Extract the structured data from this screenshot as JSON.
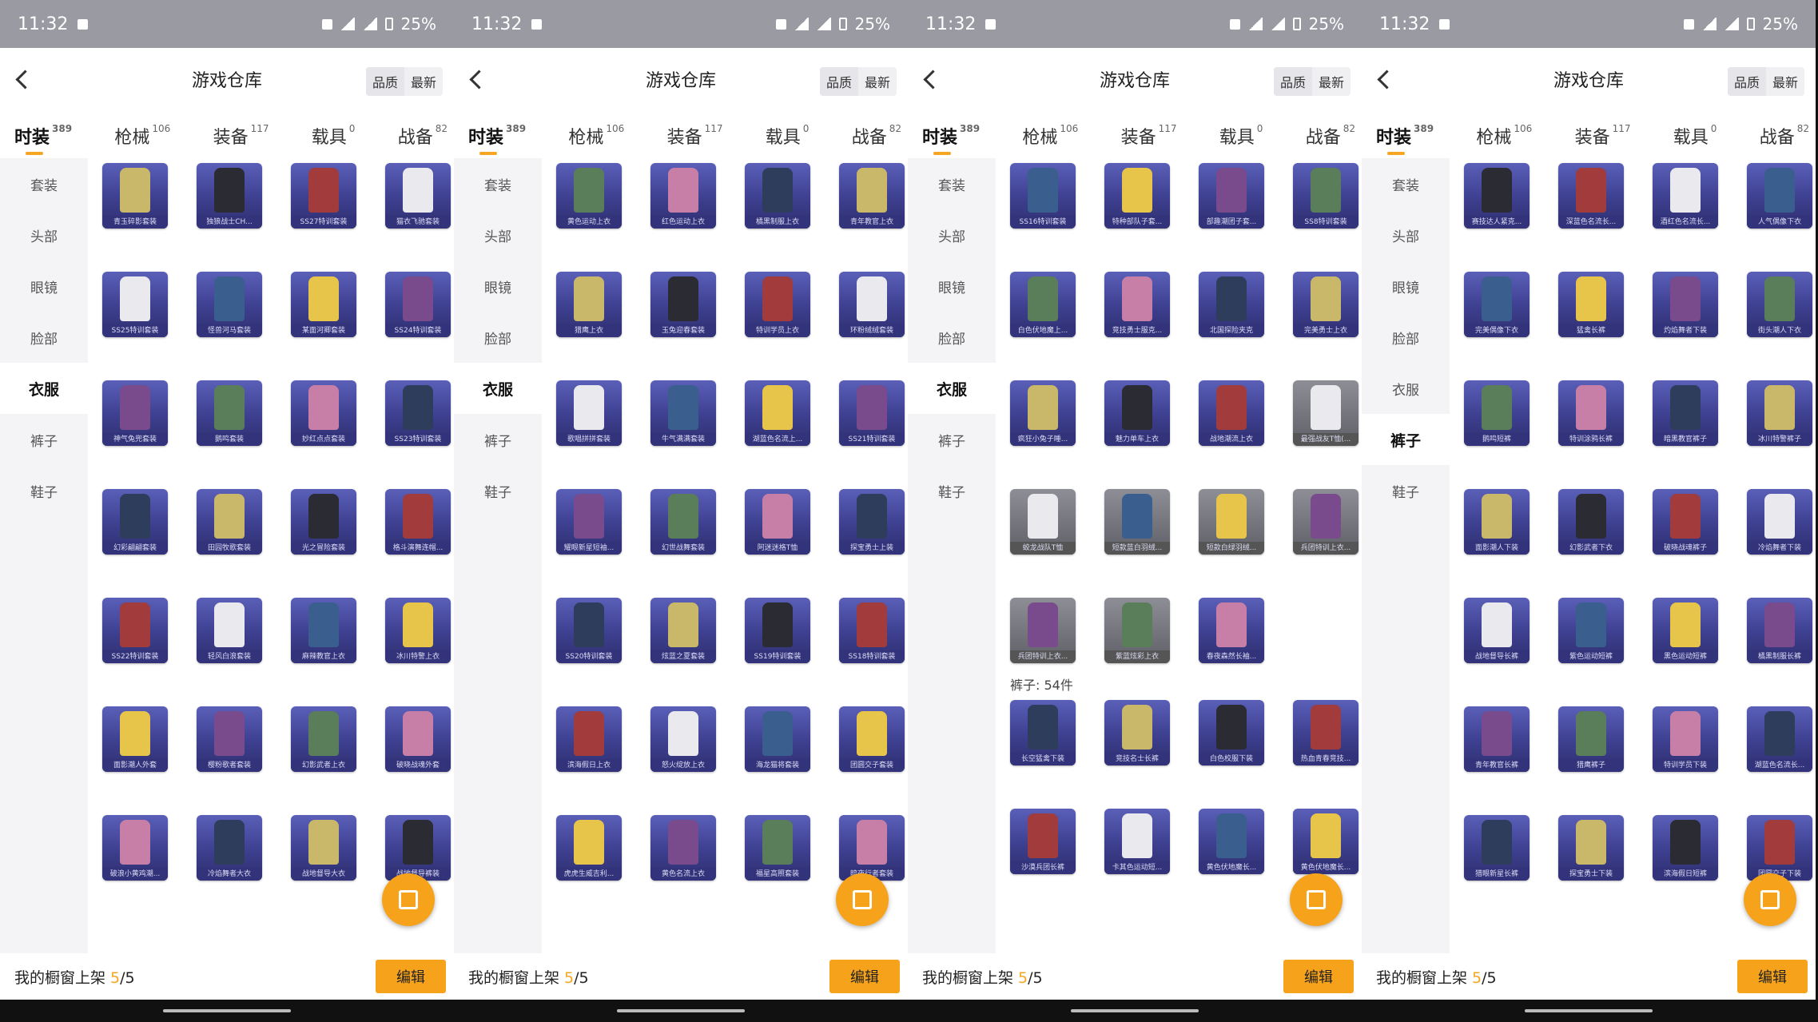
{
  "status": {
    "time": "11:32",
    "battery": "25%"
  },
  "header": {
    "title": "游戏仓库",
    "sort_quality": "品质",
    "sort_latest": "最新"
  },
  "tabs": [
    {
      "label": "时装",
      "count": "389"
    },
    {
      "label": "枪械",
      "count": "106"
    },
    {
      "label": "装备",
      "count": "117"
    },
    {
      "label": "载具",
      "count": "0"
    },
    {
      "label": "战备",
      "count": "82"
    }
  ],
  "side": [
    "套装",
    "头部",
    "眼镜",
    "脸部",
    "衣服",
    "裤子",
    "鞋子"
  ],
  "footer": {
    "label": "我的橱窗上架 ",
    "count": "5",
    "total": "/5",
    "edit": "编辑"
  },
  "colors": {
    "accent": "#f6a21b",
    "card": "#3d3f8f"
  },
  "panels": [
    {
      "active_side": 4,
      "rows": [
        [
          "青玉碎影套装",
          "独狼战士CH...",
          "SS27特训套装",
          "猫衣飞驰套装"
        ],
        [
          "SS25特训套装",
          "怪兽河马套装",
          "某面河卿套装",
          "SS24特训套装"
        ],
        [
          "神气兔兜套装",
          "鹅鸣套装",
          "妙红点点套装",
          "SS23特训套装"
        ],
        [
          "幻彩翩翩套装",
          "田园牧歌套装",
          "光之冒险套装",
          "格斗演舞连帽..."
        ],
        [
          "SS22特训套装",
          "轻风白浪套装",
          "麻辣教官上衣",
          "冰川特警上衣"
        ],
        [
          "面影潮人外套",
          "樱粉歌者套装",
          "幻影武者上衣",
          "破晓战魂外套"
        ],
        [
          "破浪小黄鸡潮...",
          "冷焰舞者大衣",
          "战地督导大衣",
          "战地督导裤装"
        ]
      ]
    },
    {
      "active_side": 4,
      "rows": [
        [
          "黄色运动上衣",
          "红色运动上衣",
          "橘黑制服上衣",
          "青年教官上衣"
        ],
        [
          "猎鹰上衣",
          "玉兔迎春套装",
          "特训学员上衣",
          "环粉绒绒套装"
        ],
        [
          "歌唱拼拼套装",
          "牛气满满套装",
          "湖蓝色名流上...",
          "SS21特训套装"
        ],
        [
          "耀眼新星短袖...",
          "幻世战舞套装",
          "阿迷迷格T恤",
          "探宝勇士上装"
        ],
        [
          "SS20特训套装",
          "炫蓝之夏套装",
          "SS19特训套装",
          "SS18特训套装"
        ],
        [
          "滨海假日上衣",
          "怒火绽放上衣",
          "海龙猫将套装",
          "团圆交子套装"
        ],
        [
          "虎虎生威吉利...",
          "黄色名流上衣",
          "福星高照套装",
          "暗夜行者套装"
        ]
      ]
    },
    {
      "active_side": 4,
      "section": "裤子: 54件",
      "rows": [
        [
          "SS16特训套装",
          "特种部队子套...",
          "部趣潮团子套...",
          "SS8特训套装"
        ],
        [
          "白色伏地魔上...",
          "竞技勇士服克...",
          "北国探险夹克",
          "完美勇士上衣"
        ],
        [
          "疯狂小兔子睡...",
          "魅力单车上衣",
          "战地潮流上衣",
          "最强战友T恤(..."
        ],
        [
          "蛟龙战队T恤",
          "短款蓝白羽绒...",
          "短款白绿羽绒...",
          "兵团特训上衣..."
        ],
        [
          "兵团特训上衣...",
          "紫蓝炫彩上衣",
          "春夜森然长袖..."
        ],
        [
          "长空猛禽下装",
          "竞技名士长裤",
          "白色校服下装",
          "热血青春竞技..."
        ],
        [
          "沙漠兵团长裤",
          "卡其色运动短...",
          "黄色伏地魔长...",
          "黄色伏地魔长..."
        ]
      ]
    },
    {
      "active_side": 5,
      "rows": [
        [
          "赛技达人紧克...",
          "深蓝色名流长...",
          "酒红色名流长...",
          "人气偶像下衣"
        ],
        [
          "完美偶像下衣",
          "猛禽长裤",
          "灼焰舞者下装",
          "街头潮人下衣"
        ],
        [
          "鹅鸣短裤",
          "特训涂鸦长裤",
          "暗黑教官裤子",
          "冰川特警裤子"
        ],
        [
          "面影潮人下装",
          "幻影武者下衣",
          "破晓战魂裤子",
          "冷焰舞者下装"
        ],
        [
          "战地督导长裤",
          "紫色运动短裤",
          "黑色运动短裤",
          "橘黑制服长裤"
        ],
        [
          "青年教官长裤",
          "猎鹰裤子",
          "特训学员下装",
          "湖蓝色名流长..."
        ],
        [
          "猎眼新星长裤",
          "探宝勇士下装",
          "滨海假日短裤",
          "团圆交子下装"
        ]
      ]
    }
  ]
}
